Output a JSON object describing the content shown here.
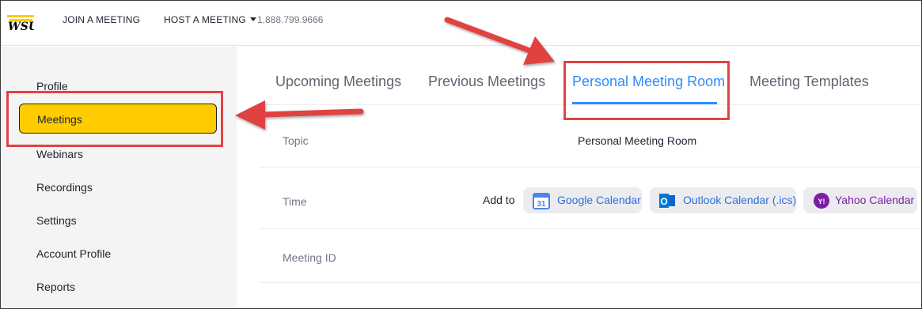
{
  "header": {
    "logo_text": "WSU",
    "join_label": "JOIN A MEETING",
    "host_label": "HOST A MEETING",
    "phone": "1.888.799.9666"
  },
  "sidebar": {
    "items": [
      {
        "label": "Profile",
        "active": false
      },
      {
        "label": "Meetings",
        "active": true
      },
      {
        "label": "Webinars",
        "active": false
      },
      {
        "label": "Recordings",
        "active": false
      },
      {
        "label": "Settings",
        "active": false
      },
      {
        "label": "Account Profile",
        "active": false
      },
      {
        "label": "Reports",
        "active": false
      }
    ]
  },
  "tabs": [
    {
      "label": "Upcoming Meetings",
      "active": false
    },
    {
      "label": "Previous Meetings",
      "active": false
    },
    {
      "label": "Personal Meeting Room",
      "active": true
    },
    {
      "label": "Meeting Templates",
      "active": false
    }
  ],
  "details": {
    "topic_label": "Topic",
    "topic_value": "Personal Meeting Room",
    "time_label": "Time",
    "add_to_label": "Add to",
    "meeting_id_label": "Meeting ID"
  },
  "calendar_buttons": {
    "google": {
      "label": "Google Calendar",
      "icon_text": "31",
      "icon": "google-calendar-icon"
    },
    "outlook": {
      "label": "Outlook Calendar (.ics)",
      "icon_text": "O",
      "icon": "outlook-icon"
    },
    "yahoo": {
      "label": "Yahoo Calendar",
      "icon_text": "Y!",
      "icon": "yahoo-icon"
    }
  },
  "colors": {
    "accent_blue": "#2d8cff",
    "active_sidebar": "#ffcc00",
    "annotation_red": "#e04343",
    "yahoo_purple": "#7b1fa2"
  }
}
